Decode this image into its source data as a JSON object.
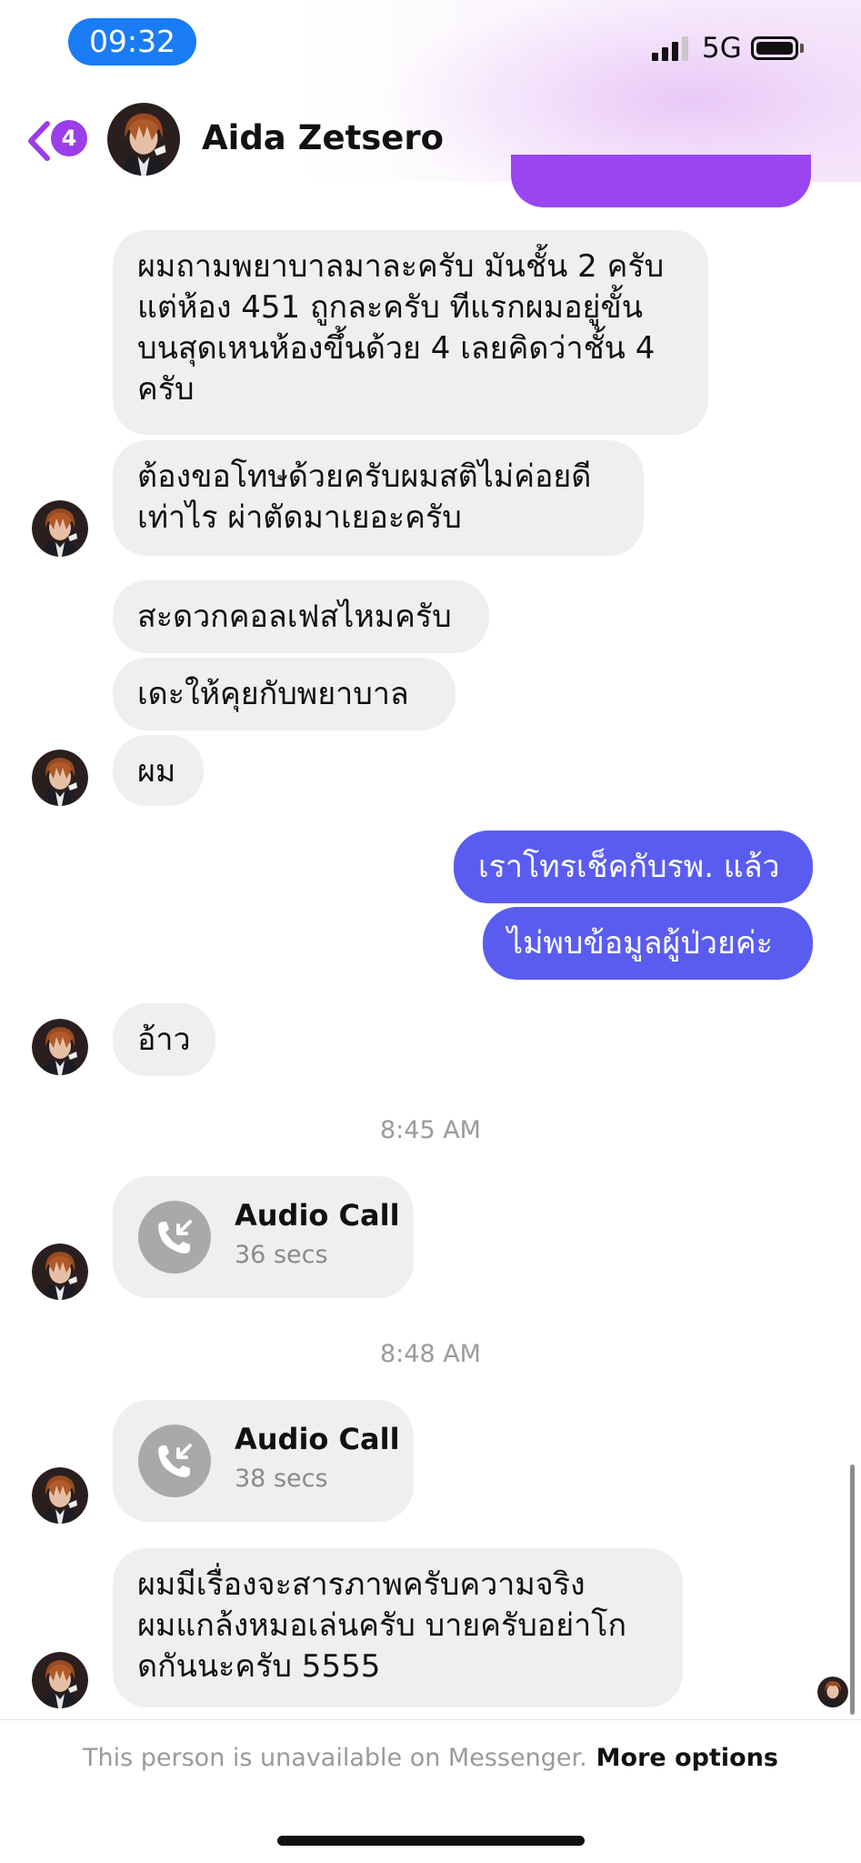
{
  "status_bar": {
    "time": "09:32",
    "network": "5G"
  },
  "header": {
    "back_badge": "4",
    "contact_name": "Aida Zetsero"
  },
  "messages": [
    {
      "text": "ผมถามพยาบาลมาละครับ มันชั้น 2 ครับ\nแต่ห้อง 451 ถูกละครับ ทีแรกผมอยู่ขั้น\nบนสุดเหนห้องขึ้นด้วย 4 เลยคิดว่าชั้น 4\nครับ"
    },
    {
      "text": "ต้องขอโทษด้วยครับผมสติไม่ค่อยดี\nเท่าไร ผ่าตัดมาเยอะครับ"
    },
    {
      "text": "สะดวกคอลเฟสไหมครับ"
    },
    {
      "text": "เดะให้คุยกับพยาบาล"
    },
    {
      "text": "ผม"
    },
    {
      "text": "เราโทรเช็คกับรพ. แล้ว"
    },
    {
      "text": "ไม่พบข้อมูลผู้ป่วยค่ะ"
    },
    {
      "text": "อ้าว"
    },
    {
      "text": "ผมมีเรื่องจะสารภาพครับความจริง\nผมแกล้งหมอเล่นครับ บายครับอย่าโก\nดกันนะครับ 5555"
    }
  ],
  "timestamps": [
    "8:45 AM",
    "8:48 AM"
  ],
  "calls": [
    {
      "title": "Audio Call",
      "duration": "36 secs"
    },
    {
      "title": "Audio Call",
      "duration": "38 secs"
    }
  ],
  "footer": {
    "notice": "This person is unavailable on Messenger.",
    "link": "More options"
  },
  "colors": {
    "outgoing_bubble": "#5a5cf0",
    "incoming_bubble": "#efefef",
    "badge": "#9b3de8",
    "status_time_pill": "#1a7cf5"
  },
  "icons": [
    "back-chevron-icon",
    "signal-icon",
    "battery-icon",
    "incoming-call-icon"
  ]
}
